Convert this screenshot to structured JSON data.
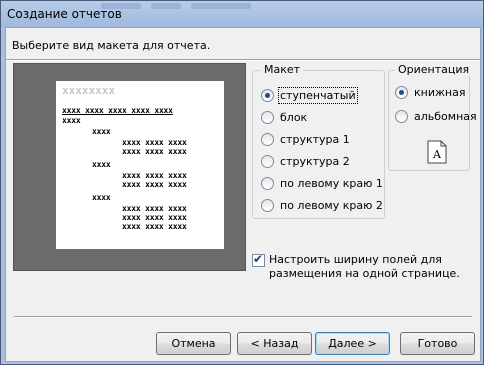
{
  "window": {
    "title": "Создание отчетов"
  },
  "instruction": "Выберите вид макета для отчета.",
  "preview": {
    "title_placeholder": "xxxxxxxx",
    "header_row": "xxxx xxxx xxxx xxxx xxxx",
    "level1": "xxxx",
    "level2": "xxxx",
    "level3": "xxxx",
    "detail": "xxxx xxxx xxxx"
  },
  "layout_group": {
    "legend": "Макет",
    "options": [
      {
        "label": "ступенчатый",
        "selected": true
      },
      {
        "label": "блок",
        "selected": false
      },
      {
        "label": "структура 1",
        "selected": false
      },
      {
        "label": "структура 2",
        "selected": false
      },
      {
        "label": "по левому краю 1",
        "selected": false
      },
      {
        "label": "по левому краю 2",
        "selected": false
      }
    ]
  },
  "orientation_group": {
    "legend": "Ориентация",
    "options": [
      {
        "label": "книжная",
        "selected": true
      },
      {
        "label": "альбомная",
        "selected": false
      }
    ],
    "icon_letter": "A"
  },
  "fit_checkbox": {
    "checked": true,
    "label": "Настроить ширину полей для размещения на одной странице."
  },
  "buttons": {
    "cancel": "Отмена",
    "back": "< Назад",
    "next": "Далее >",
    "finish": "Готово"
  }
}
